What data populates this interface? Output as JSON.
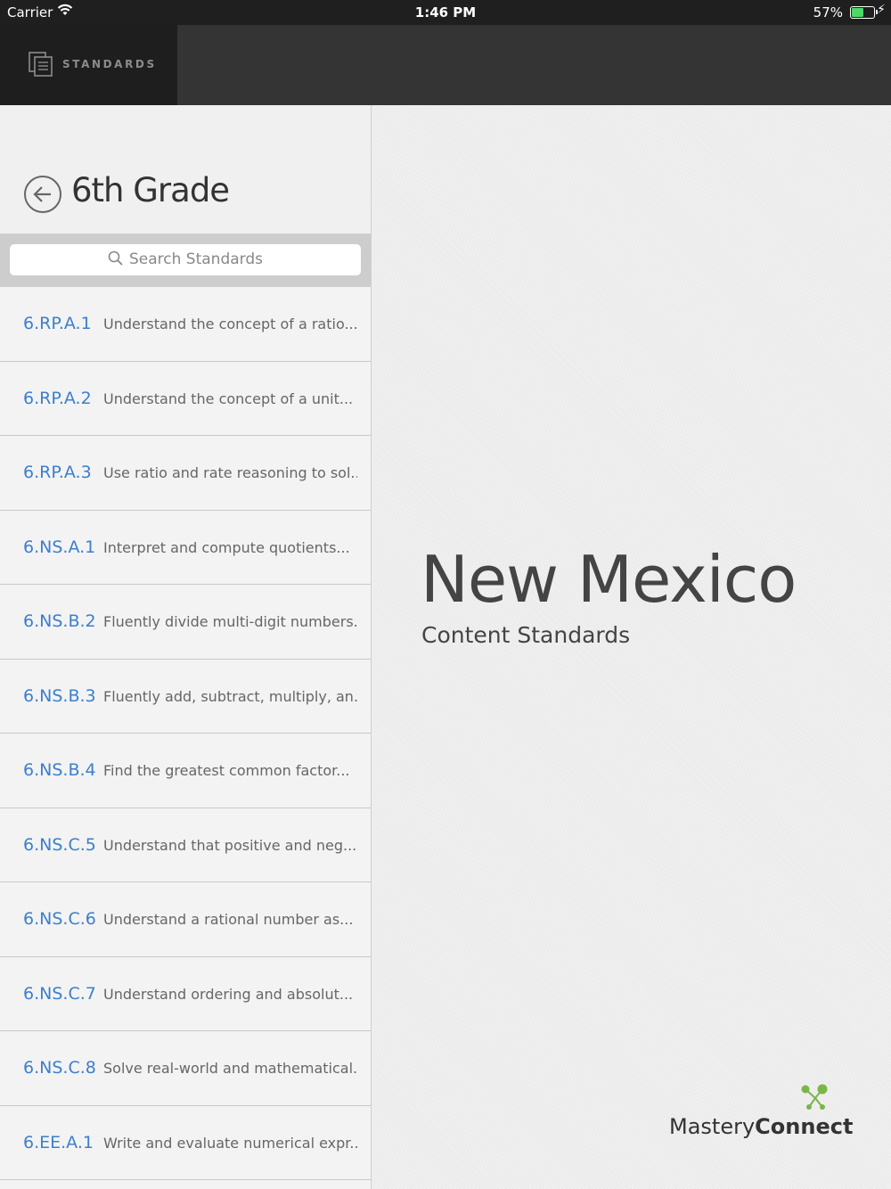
{
  "status_bar": {
    "carrier": "Carrier",
    "time": "1:46 PM",
    "battery_percent": "57%",
    "battery_level": 0.57
  },
  "nav": {
    "tab_label": "STANDARDS",
    "tab_icon": "document-stack-icon"
  },
  "left_panel": {
    "title": "6th Grade",
    "search_placeholder": "Search Standards",
    "standards": [
      {
        "code": "6.RP.A.1",
        "desc": "Understand the concept of a ratio..."
      },
      {
        "code": "6.RP.A.2",
        "desc": "Understand the concept of a unit..."
      },
      {
        "code": "6.RP.A.3",
        "desc": "Use ratio and rate reasoning to sol..."
      },
      {
        "code": "6.NS.A.1",
        "desc": "Interpret and compute quotients..."
      },
      {
        "code": "6.NS.B.2",
        "desc": "Fluently divide multi-digit numbers..."
      },
      {
        "code": "6.NS.B.3",
        "desc": "Fluently add, subtract, multiply, an..."
      },
      {
        "code": "6.NS.B.4",
        "desc": "Find the greatest common factor..."
      },
      {
        "code": "6.NS.C.5",
        "desc": "Understand that positive and neg..."
      },
      {
        "code": "6.NS.C.6",
        "desc": "Understand a rational number as..."
      },
      {
        "code": "6.NS.C.7",
        "desc": "Understand ordering and absolut..."
      },
      {
        "code": "6.NS.C.8",
        "desc": "Solve real-world and mathematical..."
      },
      {
        "code": "6.EE.A.1",
        "desc": "Write and evaluate numerical expr..."
      }
    ]
  },
  "right_panel": {
    "state_title": "New Mexico",
    "subtitle": "Content Standards",
    "brand_light": "Mastery",
    "brand_bold": "Connect"
  },
  "colors": {
    "accent_blue": "#3c7fcc",
    "logo_green": "#7ab648",
    "battery_green": "#4cd964"
  }
}
